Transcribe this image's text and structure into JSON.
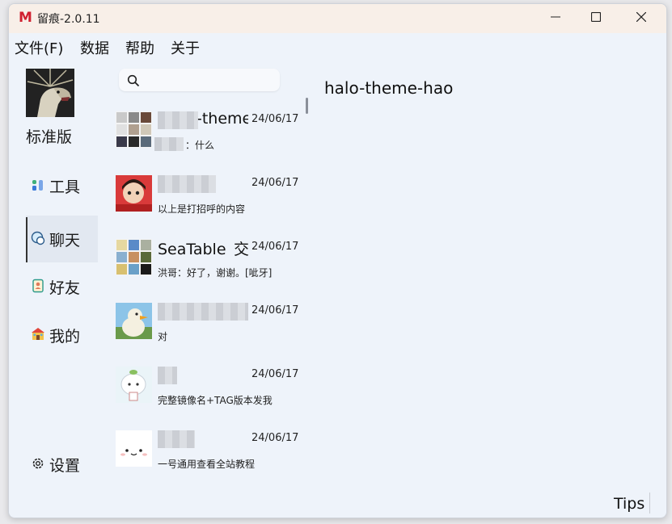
{
  "window": {
    "title": "留痕-2.0.11",
    "logo_letter": "M"
  },
  "menu": [
    {
      "label": "文件(F)"
    },
    {
      "label": "数据"
    },
    {
      "label": "帮助"
    },
    {
      "label": "关于"
    }
  ],
  "profile": {
    "edition": "标准版"
  },
  "nav": [
    {
      "label": "工具",
      "icon": "tools-icon",
      "active": false
    },
    {
      "label": "聊天",
      "icon": "chat-icon",
      "active": true
    },
    {
      "label": "好友",
      "icon": "contacts-icon",
      "active": false
    },
    {
      "label": "我的",
      "icon": "house-icon",
      "active": false
    }
  ],
  "settings": {
    "label": "设置"
  },
  "chats": [
    {
      "name": "-theme",
      "date": "24/06/17",
      "preview": "：什么"
    },
    {
      "name": "",
      "date": "24/06/17",
      "preview": "以上是打招呼的内容"
    },
    {
      "name": "SeaTable_交",
      "date": "24/06/17",
      "preview": "洪哥：好了，谢谢。[呲牙]"
    },
    {
      "name": "",
      "date": "24/06/17",
      "preview": "对"
    },
    {
      "name": "",
      "date": "24/06/17",
      "preview": "完整镜像名+TAG版本发我"
    },
    {
      "name": "",
      "date": "24/06/17",
      "preview": "一号通用查看全站教程"
    }
  ],
  "content": {
    "title": "halo-theme-hao"
  },
  "footer": {
    "tips": "Tips"
  },
  "colors": {
    "titlebar": "#f8efe8",
    "window_bg": "#eef3fa",
    "logo_red": "#d02030"
  }
}
